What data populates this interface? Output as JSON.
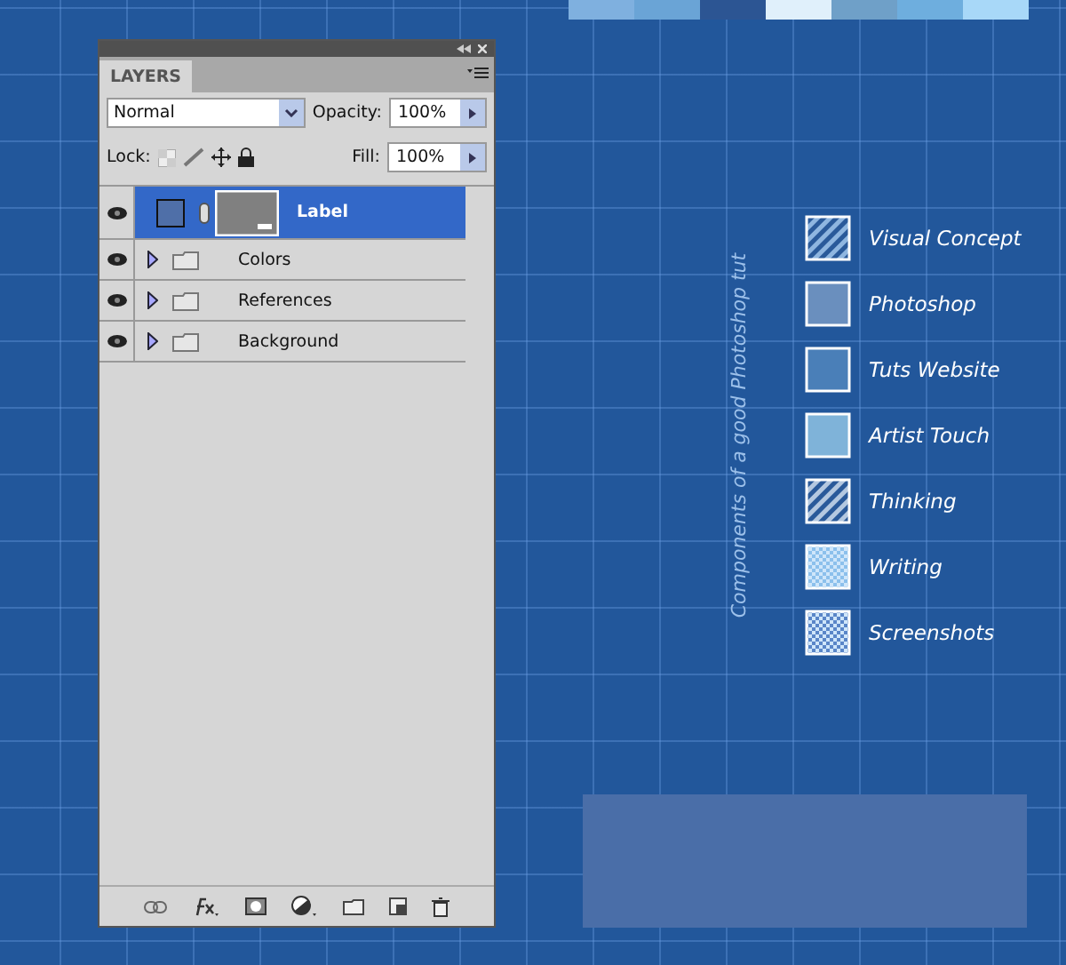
{
  "palette": [
    {
      "color": "#7fb0df"
    },
    {
      "color": "#6aa4d6"
    },
    {
      "color": "#2c5593"
    },
    {
      "color": "#e0f0fb"
    },
    {
      "color": "#6fa0c8"
    },
    {
      "color": "#6eaede"
    },
    {
      "color": "#a8d8f8"
    }
  ],
  "layers_panel": {
    "tab": {
      "label": "LAYERS",
      "selected": true
    },
    "blend_mode": "Normal",
    "opacity_label": "Opacity:",
    "opacity": "100%",
    "lock_label": "Lock:",
    "fill_label": "Fill:",
    "fill": "100%",
    "layers": [
      {
        "name": "Label",
        "kind": "layer",
        "selected": true,
        "visible": true
      },
      {
        "name": "Colors",
        "kind": "group",
        "selected": false,
        "visible": true,
        "expanded": false
      },
      {
        "name": "References",
        "kind": "group",
        "selected": false,
        "visible": true,
        "expanded": false
      },
      {
        "name": "Background",
        "kind": "group",
        "selected": false,
        "visible": true,
        "expanded": false
      }
    ]
  },
  "canvas": {
    "caption": "Components of a good Photoshop tut",
    "legend": [
      {
        "label": "Visual Concept",
        "kind": "stripes",
        "color": "#8fb6e0"
      },
      {
        "label": "Photoshop",
        "kind": "solid",
        "color": "#6a8fbe"
      },
      {
        "label": "Tuts Website",
        "kind": "solid",
        "color": "#4a7fb8"
      },
      {
        "label": "Artist Touch",
        "kind": "solid",
        "color": "#7fb3d9"
      },
      {
        "label": "Thinking",
        "kind": "stripes",
        "color": "#b4c8e0"
      },
      {
        "label": "Writing",
        "kind": "checker",
        "color": "#8cc0ec"
      },
      {
        "label": "Screenshots",
        "kind": "checker",
        "color": "#5a86c8"
      }
    ]
  }
}
